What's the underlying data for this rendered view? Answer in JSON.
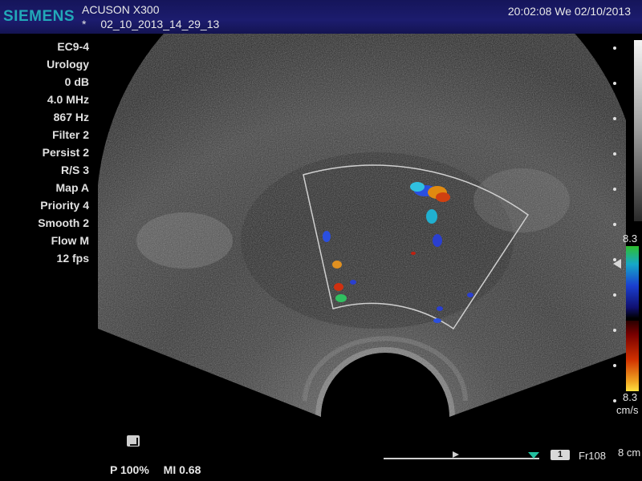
{
  "header": {
    "brand": "SIEMENS",
    "model": "ACUSON X300",
    "marker": "*",
    "study_id": "02_10_2013_14_29_13",
    "time": "20:02:08",
    "weekday": "We",
    "date": "02/10/2013"
  },
  "params": [
    "EC9-4",
    "Urology",
    "0 dB",
    "4.0 MHz",
    "867 Hz",
    "Filter 2",
    "Persist 2",
    "R/S 3",
    "Map A",
    "Priority 4",
    "Smooth 2",
    "Flow M",
    "12 fps"
  ],
  "color_scale": {
    "max": "8.3",
    "min": "8.3",
    "unit": "cm/s"
  },
  "footer": {
    "power": "P 100%",
    "mi": "MI 0.68",
    "clip": "1",
    "frame": "Fr108",
    "depth": "8 cm"
  },
  "colors": {
    "header_bg": "#1c1c6e",
    "brand": "#22a8b8",
    "roi_box": "#d0d0d0"
  },
  "icons": {
    "cine": "cine-clip-icon"
  }
}
